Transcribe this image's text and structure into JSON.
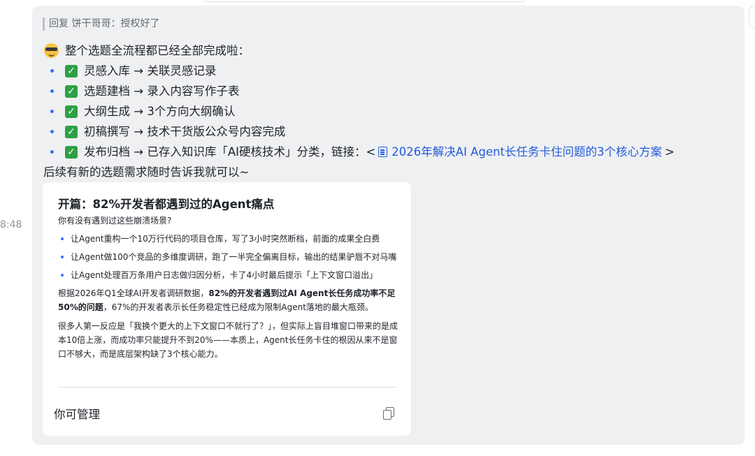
{
  "sidebar": {
    "timestamp": "8:48"
  },
  "message": {
    "reply_to": "回复 饼干哥哥：授权好了",
    "intro": "整个选题全流程都已经全部完成啦：",
    "steps": [
      {
        "label": "灵感入库 → 关联灵感记录"
      },
      {
        "label": "选题建档 → 录入内容写作子表"
      },
      {
        "label": "大纲生成 → 3个方向大纲确认"
      },
      {
        "label": "初稿撰写 → 技术干货版公众号内容完成"
      },
      {
        "label": "发布归档 → 已存入知识库「AI硬核技术」分类，链接：<",
        "link": "2026年解决AI Agent长任务卡住问题的3个核心方案",
        "suffix": ">"
      }
    ],
    "outro": "后续有新的选题需求随时告诉我就可以~"
  },
  "card": {
    "title": "开篇：82%开发者都遇到过的Agent痛点",
    "intro": "你有没有遇到过这些崩溃场景?",
    "bullets": [
      "让Agent重构一个10万行代码的项目仓库，写了3小时突然断档，前面的成果全白费",
      "让Agent做100个竞品的多维度调研，跑了一半完全偏离目标，输出的结果驴唇不对马嘴",
      "让Agent处理百万条用户日志做归因分析，卡了4小时最后提示「上下文窗口溢出」"
    ],
    "para1_prefix": "根据2026年Q1全球AI开发者调研数据，",
    "para1_bold": "82%的开发者遇到过AI Agent长任务成功率不足50%的问题",
    "para1_suffix": "，67%的开发者表示长任务稳定性已经成为限制Agent落地的最大瓶颈。",
    "para2": "很多人第一反应是「我换个更大的上下文窗口不就行了？」，但实际上盲目堆窗口带来的是成本10倍上涨，而成功率只能提升不到20%——本质上，Agent长任务卡住的根因从来不是窗口不够大，而是底层架构缺了3个核心能力。",
    "footer_label": "你可管理",
    "copy_icon": "copy-icon"
  }
}
